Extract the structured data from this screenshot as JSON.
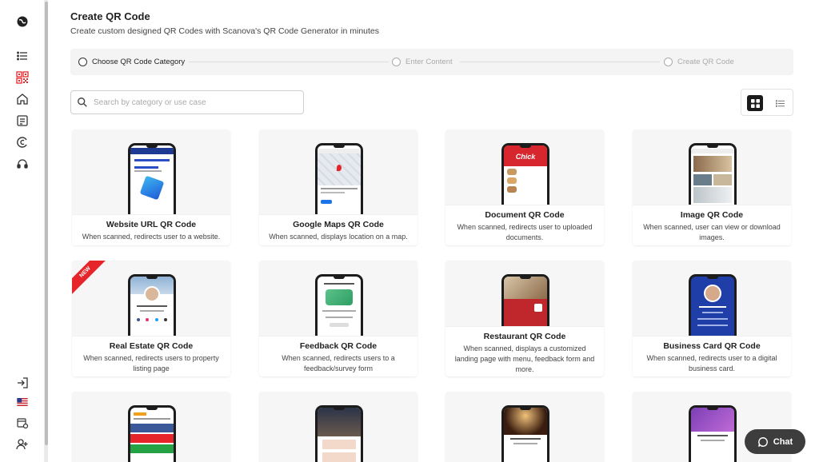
{
  "header": {
    "title": "Create QR Code",
    "subtitle": "Create custom designed QR Codes with Scanova's QR Code Generator in minutes"
  },
  "stepper": {
    "steps": [
      {
        "label": "Choose QR Code Category",
        "state": "active"
      },
      {
        "label": "Enter Content",
        "state": "inactive"
      },
      {
        "label": "Create QR Code",
        "state": "inactive"
      }
    ]
  },
  "search": {
    "placeholder": "Search by category or use case",
    "value": ""
  },
  "view_toggle": {
    "selected": "grid",
    "options": [
      "grid",
      "list"
    ]
  },
  "cards": [
    {
      "title": "Website URL QR Code",
      "desc": "When scanned, redirects user to a website.",
      "badge": ""
    },
    {
      "title": "Google Maps QR Code",
      "desc": "When scanned, displays location on a map.",
      "badge": ""
    },
    {
      "title": "Document QR Code",
      "desc": "When scanned, redirects user to uploaded documents.",
      "badge": ""
    },
    {
      "title": "Image QR Code",
      "desc": "When scanned, user can view or download images.",
      "badge": ""
    },
    {
      "title": "Real Estate QR Code",
      "desc": "When scanned, redirects users to property listing page",
      "badge": "NEW"
    },
    {
      "title": "Feedback QR Code",
      "desc": "When scanned, redirects users to a feedback/survey form",
      "badge": ""
    },
    {
      "title": "Restaurant QR Code",
      "desc": "When scanned, displays a customized landing page with menu, feedback form and more.",
      "badge": ""
    },
    {
      "title": "Business Card QR Code",
      "desc": "When scanned, redirects user to a digital business card.",
      "badge": ""
    }
  ],
  "chat": {
    "label": "Chat"
  },
  "sidebar": {
    "icons": [
      "globe-icon",
      "list-icon",
      "qr-code-icon",
      "home-icon",
      "document-icon",
      "copyright-icon",
      "headset-icon",
      "logout-icon",
      "us-flag-icon",
      "calendar-settings-icon",
      "add-user-icon"
    ]
  },
  "colors": {
    "accent": "#e5252a",
    "dark": "#1a1a1a"
  }
}
